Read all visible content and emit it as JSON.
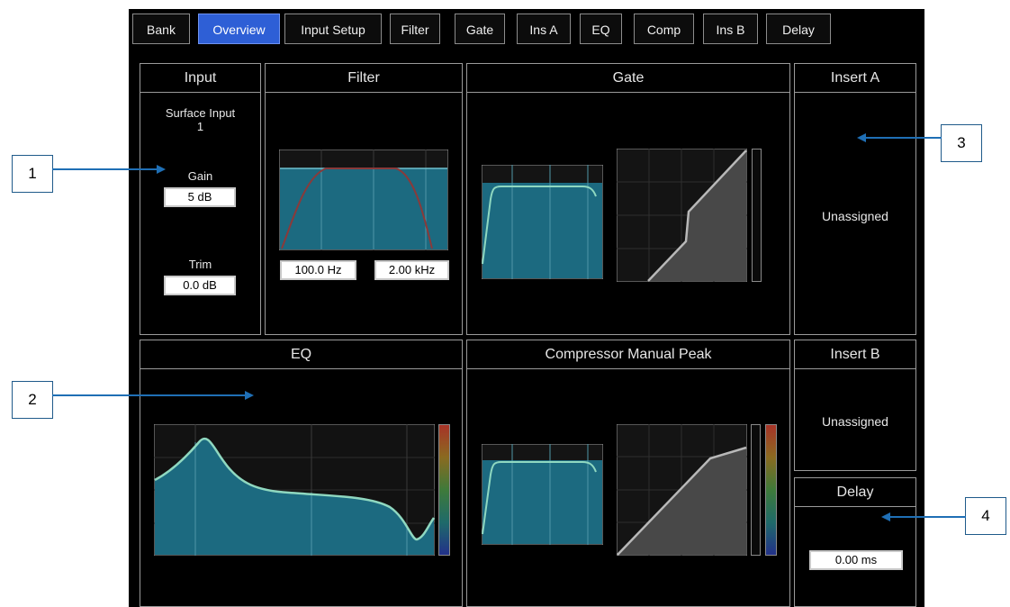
{
  "tabs": [
    "Bank",
    "Overview",
    "Input Setup",
    "Filter",
    "Gate",
    "Ins A",
    "EQ",
    "Comp",
    "Ins B",
    "Delay"
  ],
  "active_tab": "Overview",
  "input": {
    "title": "Input",
    "source_line1": "Surface Input",
    "source_line2": "1",
    "gain_label": "Gain",
    "gain_value": "5 dB",
    "trim_label": "Trim",
    "trim_value": "0.0 dB"
  },
  "filter": {
    "title": "Filter",
    "hpf_value": "100.0 Hz",
    "lpf_value": "2.00 kHz"
  },
  "gate": {
    "title": "Gate"
  },
  "insert_a": {
    "title": "Insert A",
    "status": "Unassigned"
  },
  "eq": {
    "title": "EQ"
  },
  "compressor": {
    "title": "Compressor Manual Peak"
  },
  "insert_b": {
    "title": "Insert B",
    "status": "Unassigned"
  },
  "delay": {
    "title": "Delay",
    "value": "0.00 ms"
  },
  "callouts": [
    "1",
    "2",
    "3",
    "4"
  ],
  "colors": {
    "screen": "#000000",
    "tab_active": "#2e5fd6",
    "graph_fill": "#1c6a80",
    "curve": "#8fd8c0",
    "arrow": "#1f6fb5"
  }
}
